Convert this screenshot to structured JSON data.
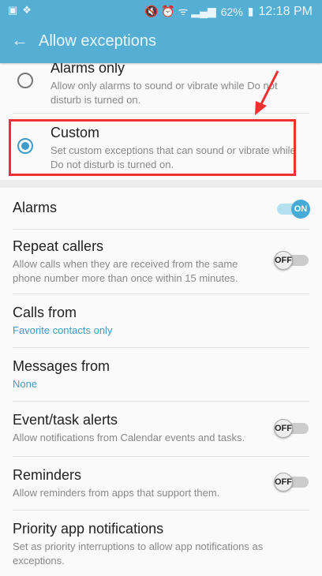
{
  "status_bar": {
    "battery": "62%",
    "time": "12:18 PM"
  },
  "toolbar": {
    "title": "Allow exceptions"
  },
  "options": [
    {
      "title": "Alarms only",
      "desc": "Allow only alarms to sound or vibrate while Do not disturb is turned on.",
      "selected": false
    },
    {
      "title": "Custom",
      "desc": "Set custom exceptions that can sound or vibrate while Do not disturb is turned on.",
      "selected": true
    }
  ],
  "settings": [
    {
      "title": "Alarms",
      "toggle": "ON"
    },
    {
      "title": "Repeat callers",
      "desc": "Allow calls when they are received from the same phone number more than once within 15 minutes.",
      "toggle": "OFF"
    },
    {
      "title": "Calls from",
      "value": "Favorite contacts only"
    },
    {
      "title": "Messages from",
      "value": "None"
    },
    {
      "title": "Event/task alerts",
      "desc": "Allow notifications from Calendar events and tasks.",
      "toggle": "OFF"
    },
    {
      "title": "Reminders",
      "desc": "Allow reminders from apps that support them.",
      "toggle": "OFF"
    },
    {
      "title": "Priority app notifications",
      "desc": "Set as priority interruptions to allow app notifications as exceptions."
    }
  ],
  "colors": {
    "accent": "#55afd4",
    "highlight": "#f03030"
  }
}
